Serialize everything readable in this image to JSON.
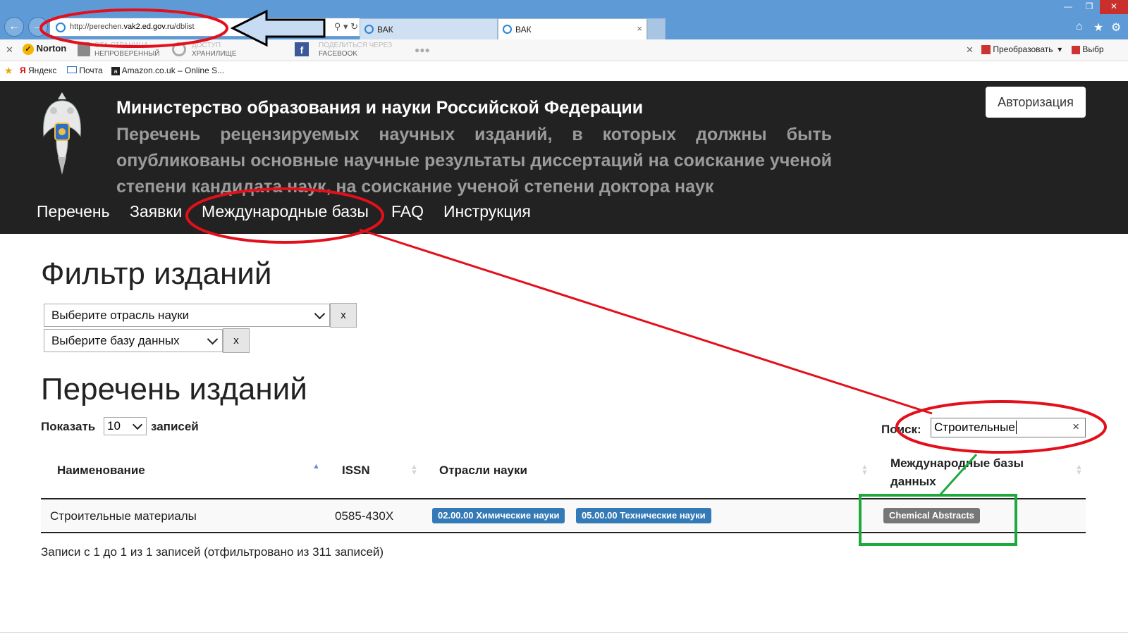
{
  "browser": {
    "url_prefix": "http://perechen.",
    "url_domain": "vak2.ed.gov.ru",
    "url_path": "/dblist",
    "tabs": [
      {
        "title": "ВАК"
      },
      {
        "title": "ВАК"
      }
    ],
    "tab_close": "×",
    "toolbar": {
      "norton": "Norton",
      "unverified_1": "ЭТА СТРАНИЦА",
      "unverified_2": "НЕПРОВЕРЕННЫЙ",
      "vault_1": "ДОСТУП",
      "vault_2": "ХРАНИЛИЩЕ",
      "share_1": "ПОДЕЛИТЬСЯ ЧЕРЕЗ",
      "share_2": "FACEBOOK",
      "more": "●●●",
      "convert": "Преобразовать",
      "select": "Выбр"
    },
    "favorites": [
      {
        "label": "Яндекс"
      },
      {
        "label": "Почта"
      },
      {
        "label": "Amazon.co.uk – Online S..."
      }
    ]
  },
  "header": {
    "ministry": "Министерство образования и науки Российской Федерации",
    "subtitle": "Перечень рецензируемых научных изданий, в которых должны быть опубликованы основные научные результаты диссертаций на соискание ученой степени кандидата наук, на соискание ученой степени доктора наук",
    "auth_button": "Авторизация",
    "menu": [
      "Перечень",
      "Заявки",
      "Международные базы",
      "FAQ",
      "Инструкция"
    ]
  },
  "filter": {
    "title": "Фильтр изданий",
    "branch_placeholder": "Выберите отрасль науки",
    "db_placeholder": "Выберите базу данных",
    "clear": "x"
  },
  "list": {
    "title": "Перечень изданий",
    "show_label": "Показать",
    "show_value": "10",
    "records_label": "записей",
    "search_label": "Поиск:",
    "search_value": "Строительные",
    "search_clear": "×",
    "columns": {
      "name": "Наименование",
      "issn": "ISSN",
      "branches": "Отрасли науки",
      "databases_1": "Международные базы",
      "databases_2": "данных"
    },
    "rows": [
      {
        "name": "Строительные материалы",
        "issn": "0585-430X",
        "branches": [
          "02.00.00 Химические науки",
          "05.00.00 Технические науки"
        ],
        "databases": [
          "Chemical Abstracts"
        ]
      }
    ],
    "info": "Записи с 1 до 1 из 1 записей (отфильтровано из 311 записей)"
  },
  "colors": {
    "header_bg": "#222222",
    "badge_blue": "#337ab7",
    "badge_gray": "#777777",
    "annotation_red": "#e3101b",
    "annotation_green": "#1ea93c"
  },
  "icons": {
    "back": "back-arrow-icon",
    "forward": "forward-arrow-icon",
    "home": "home-icon",
    "favorites": "star-icon",
    "settings": "gear-icon"
  }
}
